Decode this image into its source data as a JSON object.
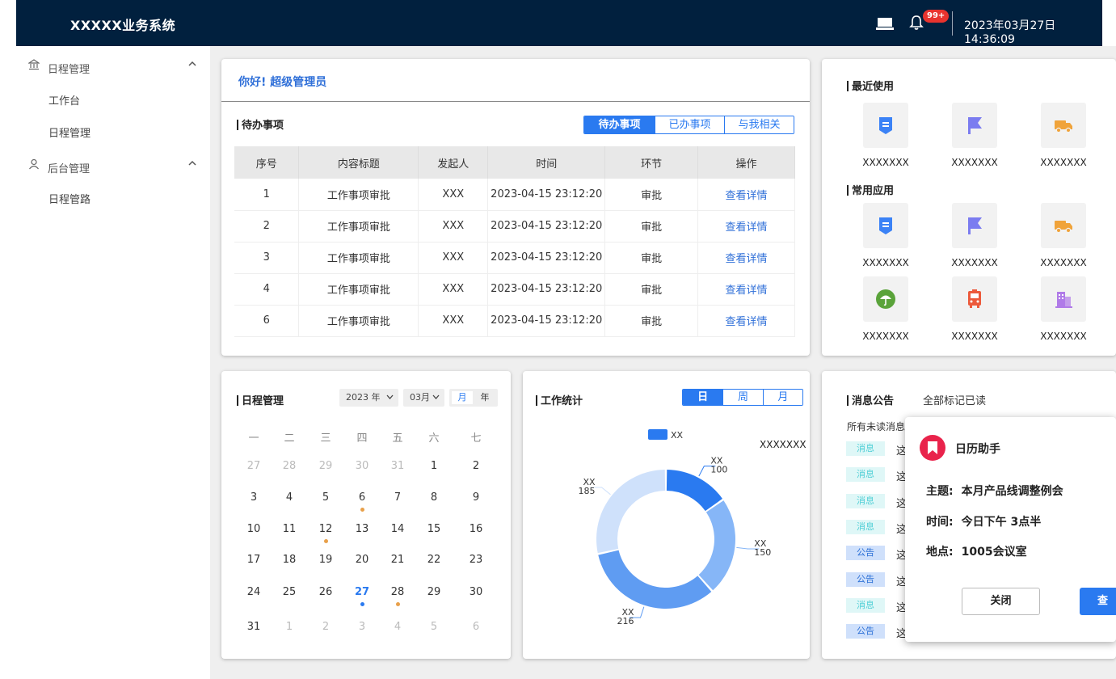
{
  "header": {
    "title": "XXXXX业务系统",
    "notification_badge": "99+",
    "datetime": "2023年03月27日 14:36:09",
    "icons": [
      "laptop-icon",
      "bell-icon"
    ]
  },
  "sidebar": {
    "groups": [
      {
        "label": "日程管理",
        "icon": "bank-icon",
        "items": [
          "工作台",
          "日程管理"
        ]
      },
      {
        "label": "后台管理",
        "icon": "user-icon",
        "items": [
          "日程管路"
        ]
      }
    ]
  },
  "todo": {
    "greeting": "你好! 超级管理员",
    "title": "待办事项",
    "tabs": [
      "待办事项",
      "已办事项",
      "与我相关"
    ],
    "active_tab": "待办事项",
    "columns": [
      "序号",
      "内容标题",
      "发起人",
      "时间",
      "环节",
      "操作"
    ],
    "rows": [
      [
        "1",
        "工作事项审批",
        "XXX",
        "2023-04-15 23:12:20",
        "审批",
        "查看详情"
      ],
      [
        "2",
        "工作事项审批",
        "XXX",
        "2023-04-15 23:12:20",
        "审批",
        "查看详情"
      ],
      [
        "3",
        "工作事项审批",
        "XXX",
        "2023-04-15 23:12:20",
        "审批",
        "查看详情"
      ],
      [
        "4",
        "工作事项审批",
        "XXX",
        "2023-04-15 23:12:20",
        "审批",
        "查看详情"
      ],
      [
        "6",
        "工作事项审批",
        "XXX",
        "2023-04-15 23:12:20",
        "审批",
        "查看详情"
      ]
    ]
  },
  "apps": {
    "recent_title": "最近使用",
    "common_title": "常用应用",
    "recent": [
      {
        "label": "XXXXXXX",
        "icon": "document-badge-icon",
        "color": "#3b82f6"
      },
      {
        "label": "XXXXXXX",
        "icon": "flag-icon",
        "color": "#7b7cf0"
      },
      {
        "label": "XXXXXXX",
        "icon": "truck-icon",
        "color": "#f0a33a"
      }
    ],
    "common": [
      {
        "label": "XXXXXXX",
        "icon": "document-badge-icon",
        "color": "#3b82f6"
      },
      {
        "label": "XXXXXXX",
        "icon": "flag-icon",
        "color": "#7b7cf0"
      },
      {
        "label": "XXXXXXX",
        "icon": "truck-icon",
        "color": "#f0a33a"
      },
      {
        "label": "XXXXXXX",
        "icon": "umbrella-icon",
        "color": "#5aa33a"
      },
      {
        "label": "XXXXXXX",
        "icon": "bus-icon",
        "color": "#ec5a3c"
      },
      {
        "label": "XXXXXXX",
        "icon": "building-icon",
        "color": "#b07be8"
      }
    ]
  },
  "calendar": {
    "title": "日程管理",
    "year_select": "2023 年",
    "month_select": "03月",
    "view_toggle": [
      "月",
      "年"
    ],
    "active_view": "月",
    "weekdays": [
      "一",
      "二",
      "三",
      "四",
      "五",
      "六",
      "七"
    ],
    "weeks": [
      [
        {
          "d": "27",
          "m": 1
        },
        {
          "d": "28",
          "m": 1
        },
        {
          "d": "29",
          "m": 1
        },
        {
          "d": "30",
          "m": 1
        },
        {
          "d": "31",
          "m": 1
        },
        {
          "d": "1"
        },
        {
          "d": "2"
        }
      ],
      [
        {
          "d": "3"
        },
        {
          "d": "4"
        },
        {
          "d": "5"
        },
        {
          "d": "6",
          "dot": "orange"
        },
        {
          "d": "7"
        },
        {
          "d": "8"
        },
        {
          "d": "9"
        }
      ],
      [
        {
          "d": "10"
        },
        {
          "d": "11"
        },
        {
          "d": "12",
          "dot": "orange"
        },
        {
          "d": "13"
        },
        {
          "d": "14"
        },
        {
          "d": "15"
        },
        {
          "d": "16"
        }
      ],
      [
        {
          "d": "17"
        },
        {
          "d": "18"
        },
        {
          "d": "19"
        },
        {
          "d": "20"
        },
        {
          "d": "21"
        },
        {
          "d": "22"
        },
        {
          "d": "23"
        }
      ],
      [
        {
          "d": "24"
        },
        {
          "d": "25"
        },
        {
          "d": "26"
        },
        {
          "d": "27",
          "today": 1,
          "dot": "blue"
        },
        {
          "d": "28",
          "dot": "orange"
        },
        {
          "d": "29"
        },
        {
          "d": "30"
        }
      ],
      [
        {
          "d": "31"
        },
        {
          "d": "1",
          "m": 1
        },
        {
          "d": "2",
          "m": 1
        },
        {
          "d": "3",
          "m": 1
        },
        {
          "d": "4",
          "m": 1
        },
        {
          "d": "5",
          "m": 1
        },
        {
          "d": "6",
          "m": 1
        }
      ]
    ]
  },
  "stats": {
    "title": "工作统计",
    "tabs": [
      "日",
      "周",
      "月"
    ],
    "active_tab": "日",
    "corner_label": "XXXXXXX"
  },
  "chart_data": {
    "type": "pie",
    "legend": [
      "XX"
    ],
    "legend_placement": "top",
    "categories": [
      "XX",
      "XX",
      "XX",
      "XX"
    ],
    "values": [
      100,
      150,
      216,
      185
    ],
    "colors": [
      "#2a7af0",
      "#86b6f7",
      "#5f9cf2",
      "#cfe1fb"
    ]
  },
  "messages": {
    "title": "消息公告",
    "mark_all": "全部标记已读",
    "filter_label": "所有未读消息",
    "items": [
      {
        "tag": "消息",
        "type": "xiaoxi",
        "text": "这"
      },
      {
        "tag": "消息",
        "type": "xiaoxi",
        "text": "这"
      },
      {
        "tag": "消息",
        "type": "xiaoxi",
        "text": "这"
      },
      {
        "tag": "消息",
        "type": "xiaoxi",
        "text": "这"
      },
      {
        "tag": "公告",
        "type": "gonggao",
        "text": "这"
      },
      {
        "tag": "公告",
        "type": "gonggao",
        "text": "这"
      },
      {
        "tag": "消息",
        "type": "xiaoxi",
        "text": "这"
      },
      {
        "tag": "公告",
        "type": "gonggao",
        "text": "这"
      }
    ]
  },
  "popup": {
    "title": "日历助手",
    "subject_label": "主题:",
    "subject": "本月产品线调整例会",
    "time_label": "时间:",
    "time": "今日下午 3点半",
    "place_label": "地点:",
    "place": "1005会议室",
    "close_label": "关闭",
    "view_label": "查"
  }
}
